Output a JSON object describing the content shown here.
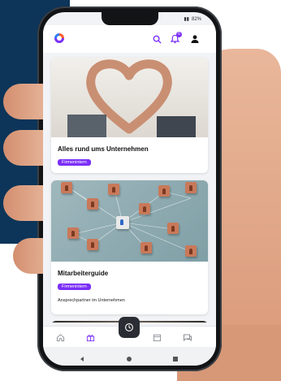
{
  "status": {
    "battery": "82%"
  },
  "appbar": {
    "logo": "app-logo",
    "icons": [
      "search-icon",
      "bell-icon",
      "user-icon"
    ],
    "notification_count": "6"
  },
  "feed": {
    "cards": [
      {
        "title": "Alles rund ums Unternehmen",
        "tag": "Firmenintern",
        "description": ""
      },
      {
        "title": "Mitarbeiterguide",
        "tag": "Firmenintern",
        "description": "Ansprechpartner im Unternehmen"
      }
    ]
  },
  "bottom_nav": {
    "items": [
      "home-icon",
      "gift-icon",
      "clock-icon",
      "calendar-icon",
      "chat-icon"
    ],
    "active": "gift-icon"
  },
  "colors": {
    "accent": "#7b2ff7",
    "navy": "#0c3559",
    "fab": "#2a2d33"
  }
}
